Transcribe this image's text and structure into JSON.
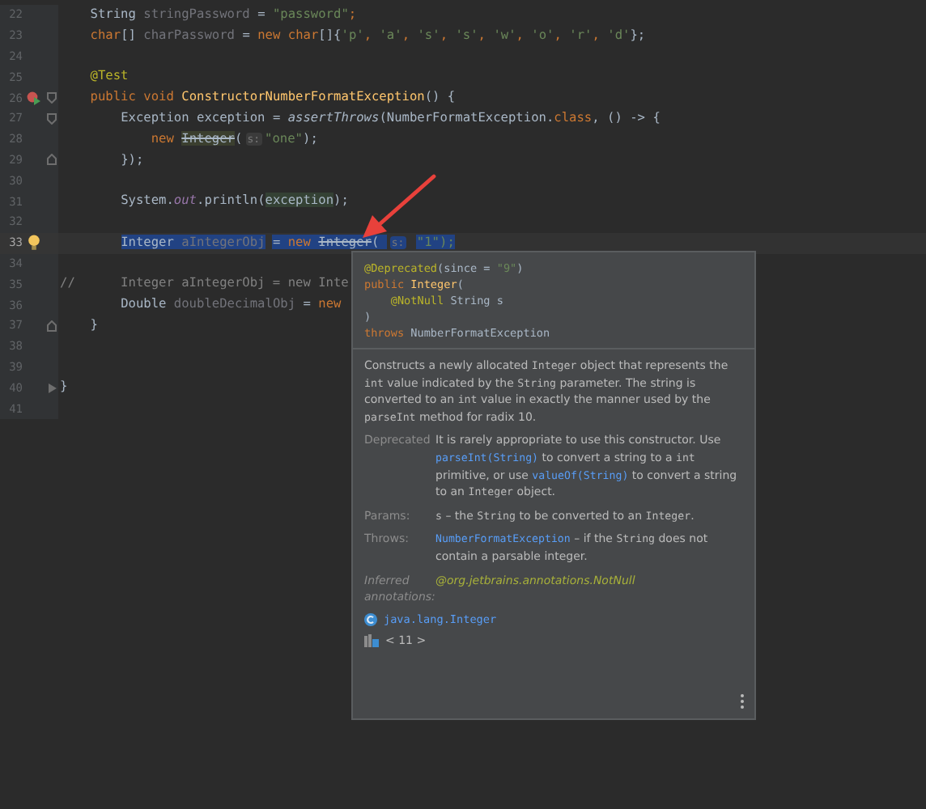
{
  "editor": {
    "lines": [
      {
        "number": "22",
        "current": false,
        "tokens": [
          {
            "text": "    String ",
            "kind": "plain"
          },
          {
            "text": "stringPassword",
            "kind": "unused"
          },
          {
            "text": " = ",
            "kind": "plain"
          },
          {
            "text": "\"password\"",
            "kind": "string"
          },
          {
            "text": ";",
            "kind": "keyword"
          }
        ]
      },
      {
        "number": "23",
        "current": false,
        "tokens": [
          {
            "text": "    char",
            "kind": "keyword"
          },
          {
            "text": "[] ",
            "kind": "plain"
          },
          {
            "text": "charPassword",
            "kind": "unused"
          },
          {
            "text": " = ",
            "kind": "plain"
          },
          {
            "text": "new char",
            "kind": "keyword"
          },
          {
            "text": "[]{",
            "kind": "plain"
          },
          {
            "text": "'p'",
            "kind": "string"
          },
          {
            "text": ", ",
            "kind": "keyword"
          },
          {
            "text": "'a'",
            "kind": "string"
          },
          {
            "text": ", ",
            "kind": "keyword"
          },
          {
            "text": "'s'",
            "kind": "string"
          },
          {
            "text": ", ",
            "kind": "keyword"
          },
          {
            "text": "'s'",
            "kind": "string"
          },
          {
            "text": ", ",
            "kind": "keyword"
          },
          {
            "text": "'w'",
            "kind": "string"
          },
          {
            "text": ", ",
            "kind": "keyword"
          },
          {
            "text": "'o'",
            "kind": "string"
          },
          {
            "text": ", ",
            "kind": "keyword"
          },
          {
            "text": "'r'",
            "kind": "string"
          },
          {
            "text": ", ",
            "kind": "keyword"
          },
          {
            "text": "'d'",
            "kind": "string"
          },
          {
            "text": "};",
            "kind": "plain"
          }
        ]
      },
      {
        "number": "24",
        "current": false
      },
      {
        "number": "25",
        "current": false,
        "tokens": [
          {
            "text": "    @Test",
            "kind": "annotation"
          }
        ]
      },
      {
        "number": "26",
        "current": false,
        "run_button": true,
        "fold_start": true,
        "tokens": [
          {
            "text": "    public void ",
            "kind": "keyword"
          },
          {
            "text": "ConstructorNumberFormatException",
            "kind": "method"
          },
          {
            "text": "() {",
            "kind": "plain"
          }
        ]
      },
      {
        "number": "27",
        "current": false,
        "fold_start": true,
        "tokens": [
          {
            "text": "        Exception exception = ",
            "kind": "plain"
          },
          {
            "text": "assertThrows",
            "kind": "static"
          },
          {
            "text": "(NumberFormatException.",
            "kind": "plain"
          },
          {
            "text": "class",
            "kind": "keyword"
          },
          {
            "text": ", () -> {",
            "kind": "plain"
          }
        ]
      },
      {
        "number": "28",
        "current": false,
        "tokens": [
          {
            "text": "            new ",
            "kind": "keyword"
          },
          {
            "text": "Integer",
            "kind": "deprecated"
          },
          {
            "text": "(",
            "kind": "plain"
          },
          {
            "text": "s:",
            "kind": "hint"
          },
          {
            "text": "\"one\"",
            "kind": "string"
          },
          {
            "text": ");",
            "kind": "plain"
          }
        ]
      },
      {
        "number": "29",
        "current": false,
        "fold_end": true,
        "tokens": [
          {
            "text": "        });",
            "kind": "plain"
          }
        ]
      },
      {
        "number": "30",
        "current": false
      },
      {
        "number": "31",
        "current": false,
        "tokens": [
          {
            "text": "        System.",
            "kind": "plain"
          },
          {
            "text": "out",
            "kind": "field"
          },
          {
            "text": ".println(",
            "kind": "plain"
          },
          {
            "text": "exception",
            "kind": "usage"
          },
          {
            "text": ");",
            "kind": "plain"
          }
        ]
      },
      {
        "number": "32",
        "current": false
      },
      {
        "number": "33",
        "current": true,
        "intention_bulb": true,
        "tokens": [
          {
            "text": "        Integer ",
            "kind": "selected"
          },
          {
            "text": "aIntegerObj",
            "kind": "selected-unused"
          },
          {
            "text": " = ",
            "kind": "selected"
          },
          {
            "text": "new ",
            "kind": "selected-keyword"
          },
          {
            "text": "Integer",
            "kind": "selected-deprecated"
          },
          {
            "text": "( ",
            "kind": "selected"
          },
          {
            "text": "s:",
            "kind": "selected-hint"
          },
          {
            "text": " \"1\");",
            "kind": "selected-string"
          }
        ]
      },
      {
        "number": "34",
        "current": false
      },
      {
        "number": "35",
        "current": false,
        "tokens": [
          {
            "text": "//      Integer aIntegerObj = new Inte",
            "kind": "comment"
          }
        ]
      },
      {
        "number": "36",
        "current": false,
        "tokens": [
          {
            "text": "        Double ",
            "kind": "plain"
          },
          {
            "text": "doubleDecimalObj",
            "kind": "unused"
          },
          {
            "text": " = ",
            "kind": "plain"
          },
          {
            "text": "new",
            "kind": "keyword"
          }
        ]
      },
      {
        "number": "37",
        "current": false,
        "fold_end": true,
        "tokens": [
          {
            "text": "    }",
            "kind": "plain"
          }
        ]
      },
      {
        "number": "38",
        "current": false
      },
      {
        "number": "39",
        "current": false
      },
      {
        "number": "40",
        "current": false,
        "collapsed": true,
        "tokens": [
          {
            "text": "}",
            "kind": "plain"
          }
        ]
      },
      {
        "number": "41",
        "current": false
      }
    ]
  },
  "popup": {
    "signature": [
      [
        {
          "text": "@Deprecated",
          "kind": "annotation"
        },
        {
          "text": "(since = ",
          "kind": "plain"
        },
        {
          "text": "\"9\"",
          "kind": "string"
        },
        {
          "text": ")",
          "kind": "plain"
        }
      ],
      [
        {
          "text": "public ",
          "kind": "keyword"
        },
        {
          "text": "Integer",
          "kind": "method"
        },
        {
          "text": "(",
          "kind": "plain"
        }
      ],
      [
        {
          "text": "    @NotNull",
          "kind": "annotation"
        },
        {
          "text": " String s",
          "kind": "plain"
        }
      ],
      [
        {
          "text": ")",
          "kind": "plain"
        }
      ],
      [
        {
          "text": "throws ",
          "kind": "keyword"
        },
        {
          "text": "NumberFormatException",
          "kind": "plain"
        }
      ]
    ],
    "description": [
      {
        "text": "Constructs a newly allocated ",
        "kind": "text"
      },
      {
        "text": "Integer",
        "kind": "code"
      },
      {
        "text": " object that represents the ",
        "kind": "text"
      },
      {
        "text": "int",
        "kind": "code"
      },
      {
        "text": " value indicated by the ",
        "kind": "text"
      },
      {
        "text": "String",
        "kind": "code"
      },
      {
        "text": " parameter. The string is converted to an ",
        "kind": "text"
      },
      {
        "text": "int",
        "kind": "code"
      },
      {
        "text": " value in exactly the manner used by the ",
        "kind": "text"
      },
      {
        "text": "parseInt",
        "kind": "code"
      },
      {
        "text": " method for radix 10.",
        "kind": "text"
      }
    ],
    "sections": [
      {
        "label": "Deprecated",
        "segments": [
          {
            "text": "It is rarely appropriate to use this constructor. Use ",
            "kind": "text"
          },
          {
            "text": "parseInt(String)",
            "kind": "link"
          },
          {
            "text": " to convert a string to a ",
            "kind": "text"
          },
          {
            "text": "int",
            "kind": "code"
          },
          {
            "text": " primitive, or use ",
            "kind": "text"
          },
          {
            "text": "valueOf(String)",
            "kind": "link"
          },
          {
            "text": " to convert a string to an ",
            "kind": "text"
          },
          {
            "text": "Integer",
            "kind": "code"
          },
          {
            "text": " object.",
            "kind": "text"
          }
        ]
      },
      {
        "label": "Params:",
        "segments": [
          {
            "text": "s",
            "kind": "code"
          },
          {
            "text": " – the ",
            "kind": "text"
          },
          {
            "text": "String",
            "kind": "code"
          },
          {
            "text": " to be converted to an ",
            "kind": "text"
          },
          {
            "text": "Integer",
            "kind": "code"
          },
          {
            "text": ".",
            "kind": "text"
          }
        ]
      },
      {
        "label": "Throws:",
        "segments": [
          {
            "text": "NumberFormatException",
            "kind": "link"
          },
          {
            "text": " – if the ",
            "kind": "text"
          },
          {
            "text": "String",
            "kind": "code"
          },
          {
            "text": " does not contain a parsable integer.",
            "kind": "text"
          }
        ]
      },
      {
        "label": "Inferred annotations:",
        "segments": [
          {
            "text": "@org.jetbrains.annotations.NotNull",
            "kind": "annotation"
          }
        ]
      }
    ],
    "class_name": "java.lang.Integer",
    "library": "< 11 >"
  }
}
